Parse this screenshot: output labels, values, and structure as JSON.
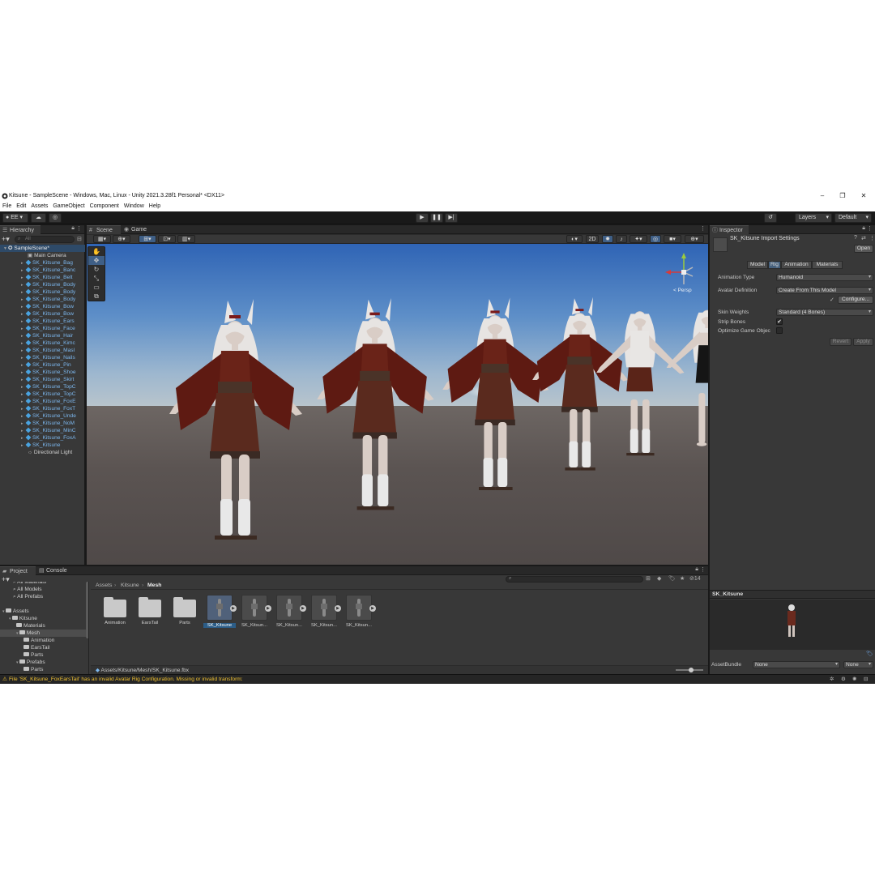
{
  "window": {
    "title": "Kitsune - SampleScene - Windows, Mac, Linux - Unity 2021.3.28f1 Personal* <DX11>"
  },
  "menu": [
    "File",
    "Edit",
    "Assets",
    "GameObject",
    "Component",
    "Window",
    "Help"
  ],
  "toolbar": {
    "account": "EE",
    "layers_label": "Layers",
    "layout_label": "Default"
  },
  "hierarchy": {
    "tab_label": "Hierarchy",
    "search_placeholder": "All",
    "scene_name": "SampleScene*",
    "items": [
      "Main Camera",
      "SK_Kitsune_Bag",
      "SK_Kitsune_Banc",
      "SK_Kitsune_Belt",
      "SK_Kitsune_Body",
      "SK_Kitsune_Body",
      "SK_Kitsune_Body",
      "SK_Kitsune_Bow",
      "SK_Kitsune_Bow",
      "SK_Kitsune_Ears",
      "SK_Kitsune_Face",
      "SK_Kitsune_Hair",
      "SK_Kitsune_Kimc",
      "SK_Kitsune_Masl",
      "SK_Kitsune_Nails",
      "SK_Kitsune_Pin",
      "SK_Kitsune_Shoe",
      "SK_Kitsune_Skirt",
      "SK_Kitsune_TopC",
      "SK_Kitsune_TopC",
      "SK_Kitsune_FoxE",
      "SK_Kitsune_FoxT",
      "SK_Kitsune_Unde",
      "SK_Kitsune_NoM",
      "SK_Kitsune_MinC",
      "SK_Kitsune_FoxA",
      "SK_Kitsune",
      "Directional Light"
    ]
  },
  "scene": {
    "tabs": [
      "Scene",
      "Game"
    ],
    "toggle_2d": "2D",
    "gizmo_label": "< Persp"
  },
  "inspector": {
    "tab_label": "Inspector",
    "header_title": "SK_Kitsune Import Settings",
    "open_button": "Open",
    "tabs": [
      "Model",
      "Rig",
      "Animation",
      "Materials"
    ],
    "animation_type_label": "Animation Type",
    "animation_type_value": "Humanoid",
    "avatar_definition_label": "Avatar Definition",
    "avatar_definition_value": "Create From This Model",
    "configure_button": "Configure...",
    "skin_weights_label": "Skin Weights",
    "skin_weights_value": "Standard (4 Bones)",
    "strip_bones_label": "Strip Bones",
    "optimize_label": "Optimize Game Objec",
    "revert_button": "Revert",
    "apply_button": "Apply",
    "preview_title": "SK_Kitsune",
    "assetbundle_label": "AssetBundle",
    "assetbundle_value": "None",
    "assetbundle_variant": "None"
  },
  "project": {
    "tabs": [
      "Project",
      "Console"
    ],
    "hidden_count": "14",
    "favorites": [
      "All Materials",
      "All Models",
      "All Prefabs"
    ],
    "tree": [
      "Assets",
      "Kitsune",
      "Materials",
      "Mesh",
      "Animation",
      "EarsTail",
      "Parts",
      "Prefabs",
      "Parts"
    ],
    "breadcrumb": [
      "Assets",
      "Kitsune",
      "Mesh"
    ],
    "assets": [
      "Animation",
      "EarsTail",
      "Parts",
      "SK_Kitsune",
      "SK_Kitsun...",
      "SK_Kitsun...",
      "SK_Kitsun...",
      "SK_Kitsun..."
    ],
    "selected_path": "Assets/Kitsune/Mesh/SK_Kitsune.fbx"
  },
  "status": {
    "message": "File 'SK_Kitsune_FoxEarsTail' has an invalid Avatar Rig Configuration. Missing or invalid transform:"
  }
}
